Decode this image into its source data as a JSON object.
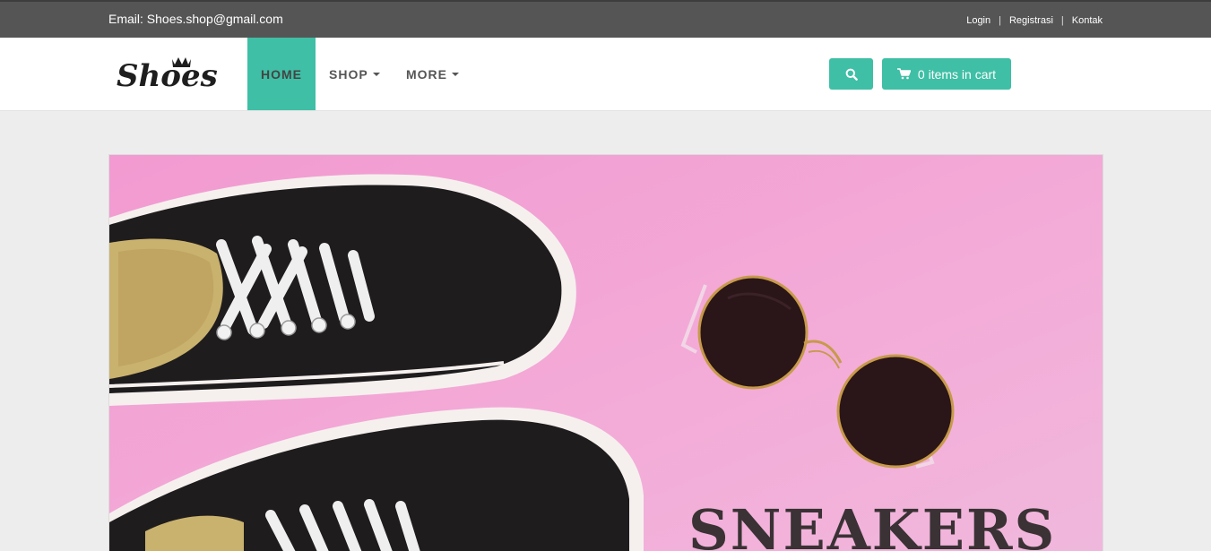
{
  "topbar": {
    "email": "Email: Shoes.shop@gmail.com",
    "links": [
      "Login",
      "Registrasi",
      "Kontak"
    ],
    "separator": "|"
  },
  "brand": {
    "logo_text": "Shoes"
  },
  "nav": {
    "items": [
      {
        "label": "HOME",
        "active": true
      },
      {
        "label": "SHOP",
        "dropdown": true
      },
      {
        "label": "MORE",
        "dropdown": true
      }
    ]
  },
  "actions": {
    "search_icon": "search-icon",
    "cart_label": "0 items in cart",
    "cart_icon": "cart-icon"
  },
  "hero": {
    "title": "SNEAKERS",
    "background": "#f3a8d6"
  },
  "colors": {
    "accent": "#3fbfa5",
    "topbar": "#555555",
    "page_bg": "#ededed"
  }
}
